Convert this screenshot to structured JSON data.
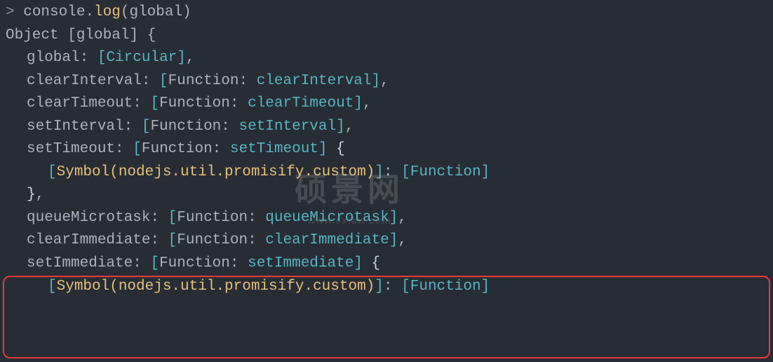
{
  "code": {
    "prompt": "> ",
    "cmd_console": "console",
    "cmd_dot": ".",
    "cmd_log": "log",
    "cmd_open": "(",
    "cmd_global": "global",
    "cmd_close": ")",
    "obj_label": "Object [",
    "obj_global": "global",
    "obj_close": "] {",
    "global_key": "global",
    "colon_sp": ": ",
    "circular_open": "[",
    "circular_text": "Circular",
    "circular_close": "]",
    "comma": ",",
    "clearInterval_key": "clearInterval",
    "clearInterval_val_open": "[",
    "clearInterval_val_fn": "Function: ",
    "clearInterval_val_name": "clearInterval",
    "clearInterval_val_close": "]",
    "clearTimeout_key": "clearTimeout",
    "clearTimeout_val_fn": "Function: ",
    "clearTimeout_val_name": "clearTimeout",
    "setInterval_key": "setInterval",
    "setInterval_val_fn": "Function: ",
    "setInterval_val_name": "setInterval",
    "setTimeout_key": "setTimeout",
    "setTimeout_val_fn": "Function: ",
    "setTimeout_val_name": "setTimeout",
    "open_brace": " {",
    "symbol_open": "[",
    "symbol_name": "Symbol(nodejs.util.promisify.custom)",
    "symbol_close": "]",
    "symbol_val_open": "[",
    "symbol_val_fn": "Function",
    "symbol_val_close": "]",
    "close_brace": "}",
    "queueMicrotask_key": "queueMicrotask",
    "queueMicrotask_val_fn": "Function: ",
    "queueMicrotask_val_name": "queueMicrotask",
    "clearImmediate_key": "clearImmediate",
    "clearImmediate_val_fn": "Function: ",
    "clearImmediate_val_name": "clearImmediate",
    "setImmediate_key": "setImmediate",
    "setImmediate_val_fn": "Function: ",
    "setImmediate_val_name": "setImmediate"
  },
  "watermark": {
    "big": "硕景网",
    "small": "www.sxlaw.com"
  }
}
